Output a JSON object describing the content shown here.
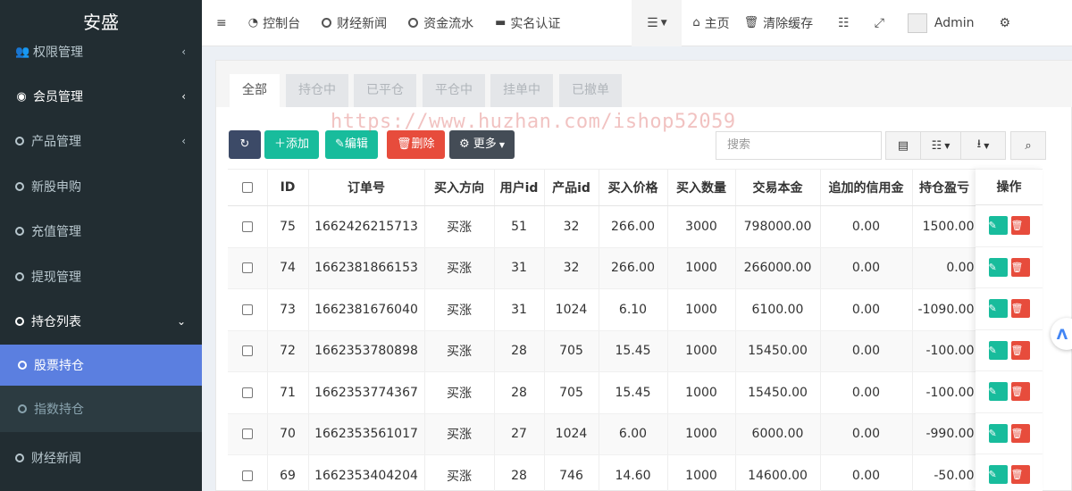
{
  "sidebar": {
    "brand": "安盛",
    "items": [
      {
        "label": "权限管理",
        "icon": "users-icon"
      },
      {
        "label": "会员管理",
        "icon": "user-circle-icon"
      },
      {
        "label": "产品管理",
        "icon": "circle-icon"
      },
      {
        "label": "新股申购",
        "icon": "circle-icon"
      },
      {
        "label": "充值管理",
        "icon": "circle-icon"
      },
      {
        "label": "提现管理",
        "icon": "circle-icon"
      },
      {
        "label": "持仓列表",
        "icon": "circle-icon"
      },
      {
        "label": "股票持仓",
        "icon": "circle-icon"
      },
      {
        "label": "指数持仓",
        "icon": "circle-icon"
      },
      {
        "label": "财经新闻",
        "icon": "circle-icon"
      }
    ]
  },
  "topbar": {
    "items": [
      {
        "label": "控制台"
      },
      {
        "label": "财经新闻"
      },
      {
        "label": "资金流水"
      },
      {
        "label": "实名认证"
      },
      {
        "label": "主页"
      },
      {
        "label": "清除缓存"
      }
    ],
    "user": "Admin"
  },
  "tabs": [
    "全部",
    "持仓中",
    "已平仓",
    "平仓中",
    "挂单中",
    "已撤单"
  ],
  "toolbar": {
    "add": "添加",
    "edit": "编辑",
    "delete": "删除",
    "more": "更多",
    "search_placeholder": "搜索"
  },
  "watermark": "https://www.huzhan.com/ishop52059",
  "table": {
    "columns": [
      "ID",
      "订单号",
      "买入方向",
      "用户id",
      "产品id",
      "买入价格",
      "买入数量",
      "交易本金",
      "追加的信用金",
      "持仓盈亏",
      "操作"
    ],
    "rows": [
      [
        "75",
        "1662426215713",
        "买涨",
        "51",
        "32",
        "266.00",
        "3000",
        "798000.00",
        "0.00",
        "1500.00"
      ],
      [
        "74",
        "1662381866153",
        "买涨",
        "31",
        "32",
        "266.00",
        "1000",
        "266000.00",
        "0.00",
        "0.00"
      ],
      [
        "73",
        "1662381676040",
        "买涨",
        "31",
        "1024",
        "6.10",
        "1000",
        "6100.00",
        "0.00",
        "-1090.00"
      ],
      [
        "72",
        "1662353780898",
        "买涨",
        "28",
        "705",
        "15.45",
        "1000",
        "15450.00",
        "0.00",
        "-100.00"
      ],
      [
        "71",
        "1662353774367",
        "买涨",
        "28",
        "705",
        "15.45",
        "1000",
        "15450.00",
        "0.00",
        "-100.00"
      ],
      [
        "70",
        "1662353561017",
        "买涨",
        "27",
        "1024",
        "6.00",
        "1000",
        "6000.00",
        "0.00",
        "-990.00"
      ],
      [
        "69",
        "1662353404204",
        "买涨",
        "28",
        "746",
        "14.60",
        "1000",
        "14600.00",
        "0.00",
        "-50.00"
      ]
    ]
  }
}
